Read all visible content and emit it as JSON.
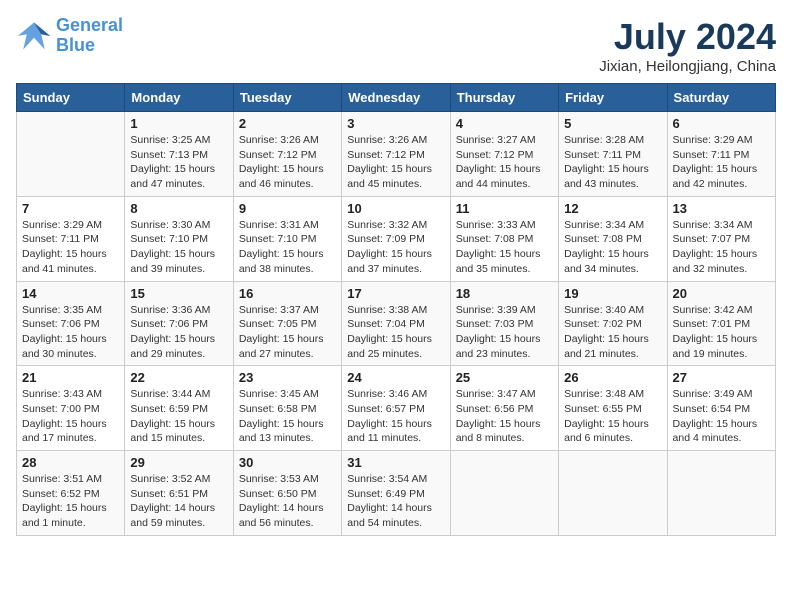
{
  "header": {
    "logo_line1": "General",
    "logo_line2": "Blue",
    "month": "July 2024",
    "location": "Jixian, Heilongjiang, China"
  },
  "days_of_week": [
    "Sunday",
    "Monday",
    "Tuesday",
    "Wednesday",
    "Thursday",
    "Friday",
    "Saturday"
  ],
  "weeks": [
    [
      {
        "day": "",
        "info": ""
      },
      {
        "day": "1",
        "info": "Sunrise: 3:25 AM\nSunset: 7:13 PM\nDaylight: 15 hours\nand 47 minutes."
      },
      {
        "day": "2",
        "info": "Sunrise: 3:26 AM\nSunset: 7:12 PM\nDaylight: 15 hours\nand 46 minutes."
      },
      {
        "day": "3",
        "info": "Sunrise: 3:26 AM\nSunset: 7:12 PM\nDaylight: 15 hours\nand 45 minutes."
      },
      {
        "day": "4",
        "info": "Sunrise: 3:27 AM\nSunset: 7:12 PM\nDaylight: 15 hours\nand 44 minutes."
      },
      {
        "day": "5",
        "info": "Sunrise: 3:28 AM\nSunset: 7:11 PM\nDaylight: 15 hours\nand 43 minutes."
      },
      {
        "day": "6",
        "info": "Sunrise: 3:29 AM\nSunset: 7:11 PM\nDaylight: 15 hours\nand 42 minutes."
      }
    ],
    [
      {
        "day": "7",
        "info": "Sunrise: 3:29 AM\nSunset: 7:11 PM\nDaylight: 15 hours\nand 41 minutes."
      },
      {
        "day": "8",
        "info": "Sunrise: 3:30 AM\nSunset: 7:10 PM\nDaylight: 15 hours\nand 39 minutes."
      },
      {
        "day": "9",
        "info": "Sunrise: 3:31 AM\nSunset: 7:10 PM\nDaylight: 15 hours\nand 38 minutes."
      },
      {
        "day": "10",
        "info": "Sunrise: 3:32 AM\nSunset: 7:09 PM\nDaylight: 15 hours\nand 37 minutes."
      },
      {
        "day": "11",
        "info": "Sunrise: 3:33 AM\nSunset: 7:08 PM\nDaylight: 15 hours\nand 35 minutes."
      },
      {
        "day": "12",
        "info": "Sunrise: 3:34 AM\nSunset: 7:08 PM\nDaylight: 15 hours\nand 34 minutes."
      },
      {
        "day": "13",
        "info": "Sunrise: 3:34 AM\nSunset: 7:07 PM\nDaylight: 15 hours\nand 32 minutes."
      }
    ],
    [
      {
        "day": "14",
        "info": "Sunrise: 3:35 AM\nSunset: 7:06 PM\nDaylight: 15 hours\nand 30 minutes."
      },
      {
        "day": "15",
        "info": "Sunrise: 3:36 AM\nSunset: 7:06 PM\nDaylight: 15 hours\nand 29 minutes."
      },
      {
        "day": "16",
        "info": "Sunrise: 3:37 AM\nSunset: 7:05 PM\nDaylight: 15 hours\nand 27 minutes."
      },
      {
        "day": "17",
        "info": "Sunrise: 3:38 AM\nSunset: 7:04 PM\nDaylight: 15 hours\nand 25 minutes."
      },
      {
        "day": "18",
        "info": "Sunrise: 3:39 AM\nSunset: 7:03 PM\nDaylight: 15 hours\nand 23 minutes."
      },
      {
        "day": "19",
        "info": "Sunrise: 3:40 AM\nSunset: 7:02 PM\nDaylight: 15 hours\nand 21 minutes."
      },
      {
        "day": "20",
        "info": "Sunrise: 3:42 AM\nSunset: 7:01 PM\nDaylight: 15 hours\nand 19 minutes."
      }
    ],
    [
      {
        "day": "21",
        "info": "Sunrise: 3:43 AM\nSunset: 7:00 PM\nDaylight: 15 hours\nand 17 minutes."
      },
      {
        "day": "22",
        "info": "Sunrise: 3:44 AM\nSunset: 6:59 PM\nDaylight: 15 hours\nand 15 minutes."
      },
      {
        "day": "23",
        "info": "Sunrise: 3:45 AM\nSunset: 6:58 PM\nDaylight: 15 hours\nand 13 minutes."
      },
      {
        "day": "24",
        "info": "Sunrise: 3:46 AM\nSunset: 6:57 PM\nDaylight: 15 hours\nand 11 minutes."
      },
      {
        "day": "25",
        "info": "Sunrise: 3:47 AM\nSunset: 6:56 PM\nDaylight: 15 hours\nand 8 minutes."
      },
      {
        "day": "26",
        "info": "Sunrise: 3:48 AM\nSunset: 6:55 PM\nDaylight: 15 hours\nand 6 minutes."
      },
      {
        "day": "27",
        "info": "Sunrise: 3:49 AM\nSunset: 6:54 PM\nDaylight: 15 hours\nand 4 minutes."
      }
    ],
    [
      {
        "day": "28",
        "info": "Sunrise: 3:51 AM\nSunset: 6:52 PM\nDaylight: 15 hours\nand 1 minute."
      },
      {
        "day": "29",
        "info": "Sunrise: 3:52 AM\nSunset: 6:51 PM\nDaylight: 14 hours\nand 59 minutes."
      },
      {
        "day": "30",
        "info": "Sunrise: 3:53 AM\nSunset: 6:50 PM\nDaylight: 14 hours\nand 56 minutes."
      },
      {
        "day": "31",
        "info": "Sunrise: 3:54 AM\nSunset: 6:49 PM\nDaylight: 14 hours\nand 54 minutes."
      },
      {
        "day": "",
        "info": ""
      },
      {
        "day": "",
        "info": ""
      },
      {
        "day": "",
        "info": ""
      }
    ]
  ]
}
